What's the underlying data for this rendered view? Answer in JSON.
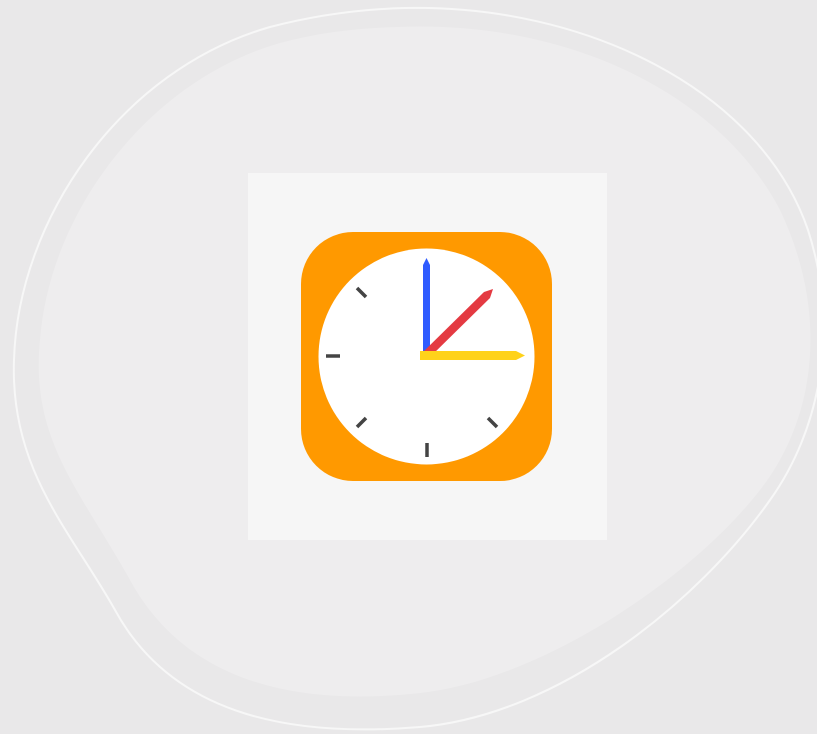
{
  "colors": {
    "background": "#e9e8e9",
    "blob_fill": "#eeedee",
    "blob_outline": "#f7f7f7",
    "card": "#f6f6f6",
    "icon_frame": "#ff9900",
    "clock_face": "#ffffff",
    "tick_marks": "#444444",
    "minute_hand": "#2f5bff",
    "hour_hand": "#e43a42",
    "second_hand": "#ffd21a"
  },
  "icon": {
    "name": "clock-app-icon"
  }
}
